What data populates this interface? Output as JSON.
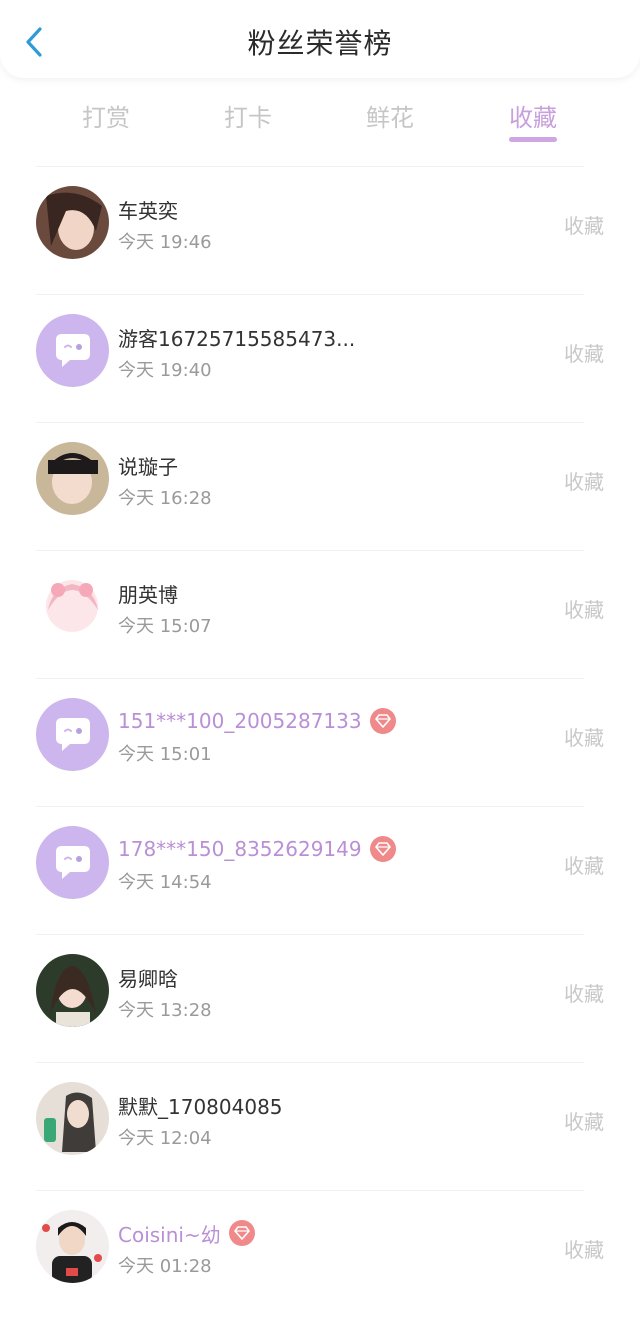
{
  "header": {
    "title": "粉丝荣誉榜",
    "back_icon": "chevron-left-icon"
  },
  "colors": {
    "accent": "#cfa5e4",
    "back": "#2e9bd6",
    "vip_name": "#b98fd6",
    "vip_badge": "#f08a8a"
  },
  "tabs": [
    {
      "label": "打赏",
      "active": false
    },
    {
      "label": "打卡",
      "active": false
    },
    {
      "label": "鲜花",
      "active": false
    },
    {
      "label": "收藏",
      "active": true
    }
  ],
  "fans": [
    {
      "name": "车英奕",
      "time": "今天 19:46",
      "action": "收藏",
      "vip": false,
      "avatar": "photo-girl-avatar"
    },
    {
      "name": "游客16725715585473...",
      "time": "今天 19:40",
      "action": "收藏",
      "vip": false,
      "avatar": "default-chat-avatar"
    },
    {
      "name": "说璇子",
      "time": "今天 16:28",
      "action": "收藏",
      "vip": false,
      "avatar": "photo-child-avatar"
    },
    {
      "name": "朋英博",
      "time": "今天 15:07",
      "action": "收藏",
      "vip": false,
      "avatar": "anime-girl-avatar"
    },
    {
      "name": "151***100_2005287133",
      "time": "今天 15:01",
      "action": "收藏",
      "vip": true,
      "avatar": "default-chat-avatar"
    },
    {
      "name": "178***150_8352629149",
      "time": "今天 14:54",
      "action": "收藏",
      "vip": true,
      "avatar": "default-chat-avatar"
    },
    {
      "name": "易卿晗",
      "time": "今天 13:28",
      "action": "收藏",
      "vip": false,
      "avatar": "photo-woman-avatar"
    },
    {
      "name": "默默_170804085",
      "time": "今天 12:04",
      "action": "收藏",
      "vip": false,
      "avatar": "photo-woman-drink-avatar"
    },
    {
      "name": "Coisini~幼",
      "time": "今天 01:28",
      "action": "收藏",
      "vip": true,
      "avatar": "photo-boy-hearts-avatar"
    }
  ]
}
